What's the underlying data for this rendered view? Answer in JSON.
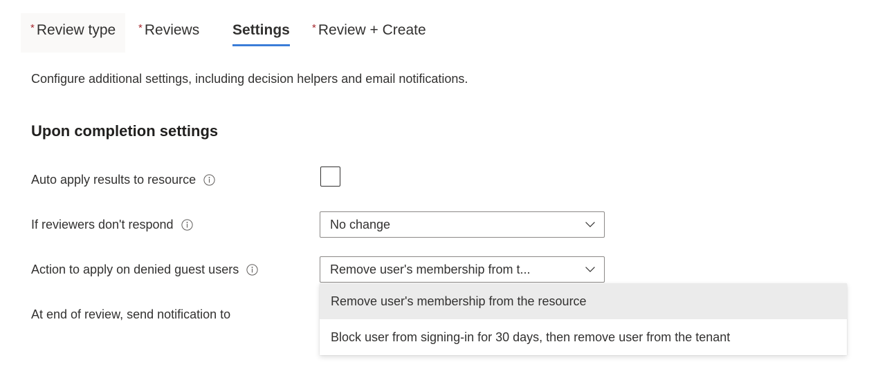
{
  "tabs": [
    {
      "label": "Review type",
      "required": true,
      "selected": false,
      "hovered": true
    },
    {
      "label": "Reviews",
      "required": true,
      "selected": false,
      "hovered": false
    },
    {
      "label": "Settings",
      "required": false,
      "selected": true,
      "hovered": false
    },
    {
      "label": "Review + Create",
      "required": true,
      "selected": false,
      "hovered": false
    }
  ],
  "page": {
    "description": "Configure additional settings, including decision helpers and email notifications.",
    "section_heading": "Upon completion settings"
  },
  "fields": {
    "auto_apply": {
      "label": "Auto apply results to resource",
      "info_icon": "info-icon",
      "checkbox_checked": false
    },
    "no_respond": {
      "label": "If reviewers don't respond",
      "info_icon": "info-icon",
      "value": "No change",
      "chevron_icon": "chevron-down-icon"
    },
    "denied_guest": {
      "label": "Action to apply on denied guest users",
      "info_icon": "info-icon",
      "value": "Remove user's membership from t...",
      "chevron_icon": "chevron-down-icon"
    },
    "notify": {
      "label": "At end of review, send notification to"
    }
  },
  "dropdown_menu": {
    "open": true,
    "options": [
      {
        "label": "Remove user's membership from the resource",
        "highlighted": true
      },
      {
        "label": "Block user from signing-in for 30 days, then remove user from the tenant",
        "highlighted": false
      }
    ]
  },
  "colors": {
    "accent": "#3b7dd8",
    "required_asterisk": "#a4262c",
    "text": "#323130",
    "menu_highlight": "#ebebeb",
    "tab_hover": "#faf9f8",
    "border": "#8a8886"
  }
}
